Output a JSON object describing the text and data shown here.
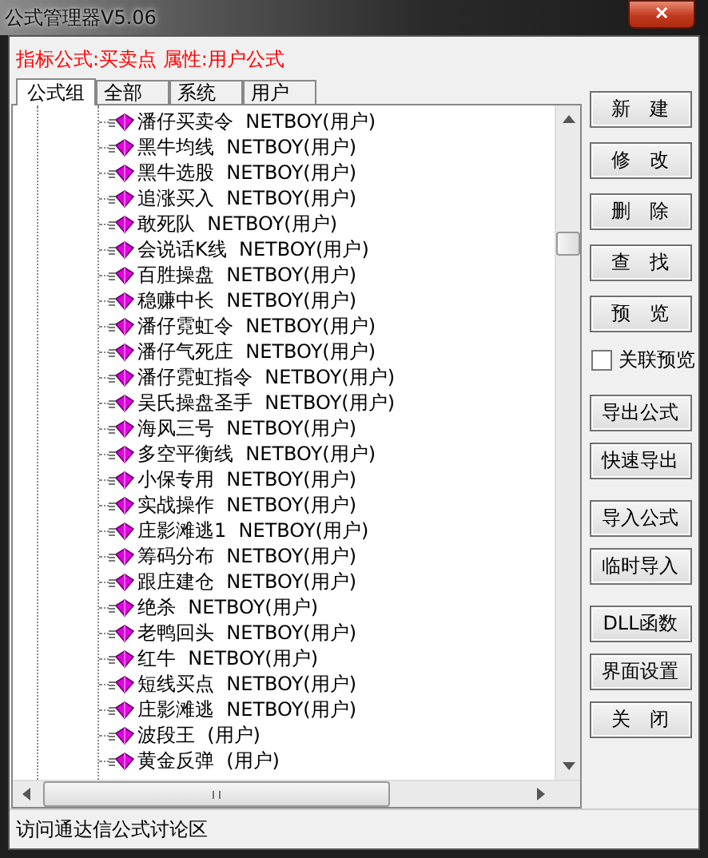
{
  "window": {
    "title": "公式管理器V5.06",
    "close_label": "✕"
  },
  "info": "指标公式:买卖点  属性:用户公式",
  "tabs": [
    {
      "label": "公式组",
      "selected": true
    },
    {
      "label": "全部",
      "selected": false
    },
    {
      "label": "系统",
      "selected": false
    },
    {
      "label": "用户",
      "selected": false
    }
  ],
  "tree_items": [
    {
      "label": "潘仔买卖令  NETBOY(用户)"
    },
    {
      "label": "黑牛均线  NETBOY(用户)"
    },
    {
      "label": "黑牛选股  NETBOY(用户)"
    },
    {
      "label": "追涨买入  NETBOY(用户)"
    },
    {
      "label": "敢死队  NETBOY(用户)"
    },
    {
      "label": "会说话K线  NETBOY(用户)"
    },
    {
      "label": "百胜操盘  NETBOY(用户)"
    },
    {
      "label": "稳赚中长  NETBOY(用户)"
    },
    {
      "label": "潘仔霓虹令  NETBOY(用户)"
    },
    {
      "label": "潘仔气死庄  NETBOY(用户)"
    },
    {
      "label": "潘仔霓虹指令  NETBOY(用户)"
    },
    {
      "label": "吴氏操盘圣手  NETBOY(用户)"
    },
    {
      "label": "海风三号  NETBOY(用户)"
    },
    {
      "label": "多空平衡线  NETBOY(用户)"
    },
    {
      "label": "小保专用  NETBOY(用户)"
    },
    {
      "label": "实战操作  NETBOY(用户)"
    },
    {
      "label": "庄影滩逃1  NETBOY(用户)"
    },
    {
      "label": "筹码分布  NETBOY(用户)"
    },
    {
      "label": "跟庄建仓  NETBOY(用户)"
    },
    {
      "label": "绝杀  NETBOY(用户)"
    },
    {
      "label": "老鸭回头  NETBOY(用户)"
    },
    {
      "label": "红牛  NETBOY(用户)"
    },
    {
      "label": "短线买点  NETBOY(用户)"
    },
    {
      "label": "庄影滩逃  NETBOY(用户)"
    },
    {
      "label": "波段王  (用户)"
    },
    {
      "label": "黄金反弹  (用户)"
    }
  ],
  "buttons_top": [
    "新　建",
    "修　改",
    "删　除",
    "查　找",
    "预　览"
  ],
  "preview_checkbox": {
    "label": "关联预览",
    "checked": false
  },
  "button_groups": [
    [
      "导出公式",
      "快速导出"
    ],
    [
      "导入公式",
      "临时导入"
    ],
    [
      "DLL函数",
      "界面设置",
      "关　闭"
    ]
  ],
  "status_bar": "访问通达信公式讨论区"
}
